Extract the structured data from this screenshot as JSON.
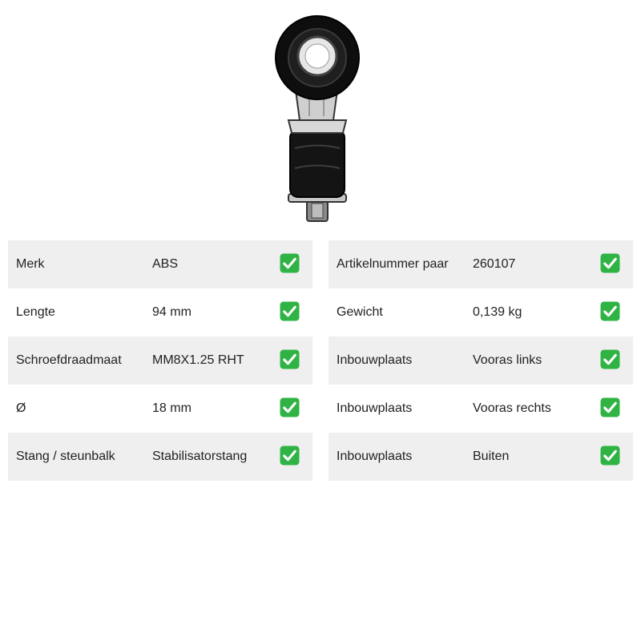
{
  "product_image": {
    "icon": "stabilizer-link-image"
  },
  "check_icon": {
    "name": "check-mark-icon",
    "color": "#2fb344"
  },
  "left_table": {
    "rows": [
      {
        "label": "Merk",
        "value": "ABS"
      },
      {
        "label": "Lengte",
        "value": "94 mm"
      },
      {
        "label": "Schroefdraadmaat",
        "value": "MM8X1.25 RHT"
      },
      {
        "label": "Ø",
        "value": "18 mm"
      },
      {
        "label": "Stang / steunbalk",
        "value": "Stabilisatorstang"
      }
    ]
  },
  "right_table": {
    "rows": [
      {
        "label": "Artikelnummer paar",
        "value": "260107"
      },
      {
        "label": "Gewicht",
        "value": "0,139 kg"
      },
      {
        "label": "Inbouwplaats",
        "value": "Vooras links"
      },
      {
        "label": "Inbouwplaats",
        "value": "Vooras rechts"
      },
      {
        "label": "Inbouwplaats",
        "value": "Buiten"
      }
    ]
  }
}
